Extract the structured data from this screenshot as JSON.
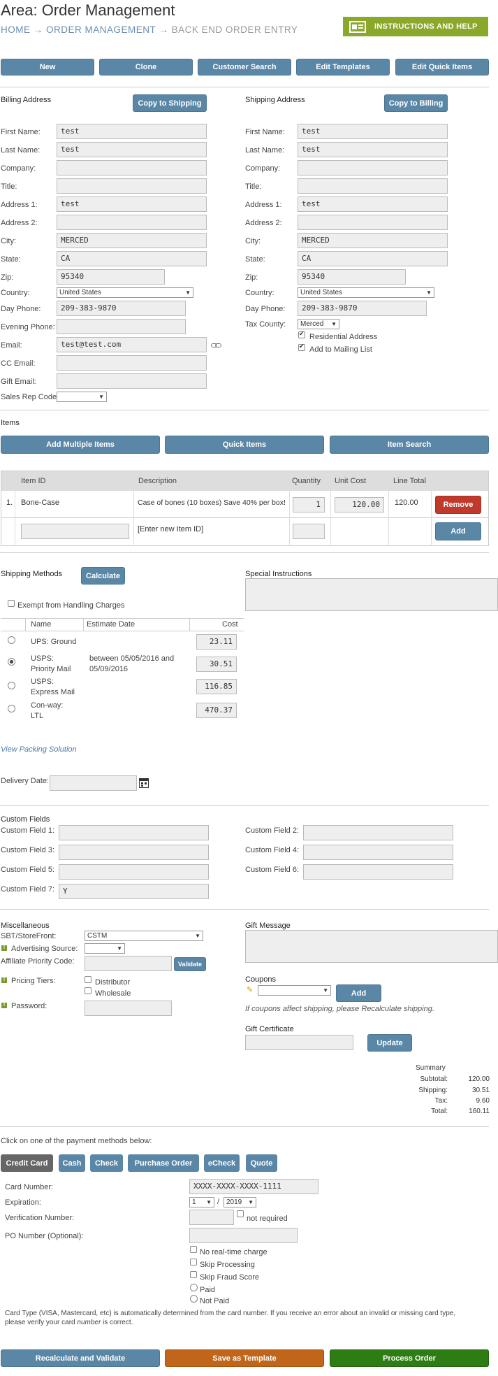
{
  "header": {
    "area_title": "Area: Order Management",
    "breadcrumb": {
      "home": "HOME",
      "arrow1": "→",
      "section": "ORDER MANAGEMENT",
      "arrow2": "→",
      "current": "BACK END ORDER ENTRY"
    },
    "help_button": "INSTRUCTIONS AND HELP"
  },
  "toolbar": {
    "new": "New",
    "clone": "Clone",
    "customer_search": "Customer Search",
    "edit_templates": "Edit Templates",
    "edit_quick_items": "Edit Quick Items"
  },
  "billing": {
    "heading": "Billing Address",
    "copy_button": "Copy to Shipping",
    "labels": {
      "first": "First Name:",
      "last": "Last Name:",
      "company": "Company:",
      "title": "Title:",
      "addr1": "Address 1:",
      "addr2": "Address 2:",
      "city": "City:",
      "state": "State:",
      "zip": "Zip:",
      "country": "Country:",
      "day_phone": "Day Phone:",
      "eve_phone": "Evening Phone:",
      "email": "Email:",
      "cc_email": "CC Email:",
      "gift_email": "Gift Email:",
      "sales_rep": "Sales Rep Code:"
    },
    "values": {
      "first": "test",
      "last": "test",
      "company": "",
      "title": "",
      "addr1": "test",
      "addr2": "",
      "city": "MERCED",
      "state": "CA",
      "zip": "95340",
      "country": "United States",
      "day_phone": "209-383-9870",
      "eve_phone": "",
      "email": "test@test.com",
      "cc_email": "",
      "gift_email": "",
      "sales_rep": ""
    }
  },
  "shipping_addr": {
    "heading": "Shipping Address",
    "copy_button": "Copy to Billing",
    "labels": {
      "first": "First Name:",
      "last": "Last Name:",
      "company": "Company:",
      "title": "Title:",
      "addr1": "Address 1:",
      "addr2": "Address 2:",
      "city": "City:",
      "state": "State:",
      "zip": "Zip:",
      "country": "Country:",
      "day_phone": "Day Phone:",
      "tax_county": "Tax County:",
      "residential": "Residential Address",
      "mailing": "Add to Mailing List"
    },
    "values": {
      "first": "test",
      "last": "test",
      "company": "",
      "title": "",
      "addr1": "test",
      "addr2": "",
      "city": "MERCED",
      "state": "CA",
      "zip": "95340",
      "country": "United States",
      "day_phone": "209-383-9870",
      "tax_county": "Merced"
    }
  },
  "items": {
    "heading": "Items",
    "add_multiple": "Add Multiple Items",
    "quick_items": "Quick Items",
    "item_search": "Item Search",
    "columns": {
      "id": "Item ID",
      "desc": "Description",
      "qty": "Quantity",
      "cost": "Unit Cost",
      "total": "Line Total"
    },
    "rows": [
      {
        "num": "1.",
        "id": "Bone-Case",
        "desc": "Case of bones (10 boxes) Save 40% per box!",
        "qty": "1",
        "cost": "120.00",
        "total": "120.00",
        "action": "Remove"
      }
    ],
    "new_row": {
      "placeholder_desc": "[Enter new Item ID]",
      "action": "Add"
    }
  },
  "shipping_methods": {
    "heading": "Shipping Methods",
    "calculate": "Calculate",
    "exempt": "Exempt from Handling Charges",
    "columns": {
      "name": "Name",
      "date": "Estimate Date",
      "cost": "Cost"
    },
    "rows": [
      {
        "name": "UPS: Ground",
        "date": "",
        "cost": "23.11"
      },
      {
        "name": "USPS:\nPriority Mail",
        "date": "between 05/05/2016 and\n05/09/2016",
        "cost": "30.51"
      },
      {
        "name": "USPS:\nExpress Mail",
        "date": "",
        "cost": "116.85"
      },
      {
        "name": "Con-way:\nLTL",
        "date": "",
        "cost": "470.37"
      }
    ],
    "packing_link": "View Packing Solution",
    "delivery_date_label": "Delivery Date:"
  },
  "special_instructions": {
    "heading": "Special Instructions"
  },
  "custom_fields": {
    "heading": "Custom Fields",
    "fields": [
      {
        "label": "Custom Field 1:",
        "value": ""
      },
      {
        "label": "Custom Field 2:",
        "value": ""
      },
      {
        "label": "Custom Field 3:",
        "value": ""
      },
      {
        "label": "Custom Field 4:",
        "value": ""
      },
      {
        "label": "Custom Field 5:",
        "value": ""
      },
      {
        "label": "Custom Field 6:",
        "value": ""
      },
      {
        "label": "Custom Field 7:",
        "value": "Y"
      }
    ]
  },
  "misc": {
    "heading": "Miscellaneous",
    "storefront_label": "SBT/StoreFront:",
    "storefront_value": "CSTM",
    "adv_label": "Advertising Source:",
    "affiliate_label": "Affiliate Priority Code:",
    "validate": "Validate",
    "pricing_label": "Pricing Tiers:",
    "distributor": "Distributor",
    "wholesale": "Wholesale",
    "password_label": "Password:"
  },
  "gift": {
    "message_heading": "Gift Message",
    "coupons_heading": "Coupons",
    "add_coupon": "Add",
    "coupon_note": "If coupons affect shipping, please Recalculate shipping.",
    "certificate_heading": "Gift Certificate",
    "update": "Update"
  },
  "summary": {
    "heading": "Summary",
    "subtotal_label": "Subtotal:",
    "subtotal": "120.00",
    "shipping_label": "Shipping:",
    "shipping": "30.51",
    "tax_label": "Tax:",
    "tax": "9.60",
    "total_label": "Total:",
    "total": "160.11"
  },
  "payment": {
    "prompt": "Click on one of the payment methods below:",
    "methods": [
      "Credit Card",
      "Cash",
      "Check",
      "Purchase Order",
      "eCheck",
      "Quote"
    ],
    "card_number_label": "Card Number:",
    "card_number": "XXXX-XXXX-XXXX-1111",
    "expiration_label": "Expiration:",
    "exp_month": "1",
    "exp_sep": "/",
    "exp_year": "2019",
    "verification_label": "Verification Number:",
    "not_required": "not required",
    "po_label": "PO Number (Optional):",
    "no_realtime": "No real-time charge",
    "skip_processing": "Skip Processing",
    "skip_fraud": "Skip Fraud Score",
    "paid": "Paid",
    "not_paid": "Not Paid",
    "note_a": "Card Type (VISA, Mastercard, etc) is automatically determined from the card number. If you receive an error about an invalid or missing card type,",
    "note_b1": "please verify your card ",
    "note_b_em": "number",
    "note_b2": " is correct."
  },
  "footer": {
    "recalculate": "Recalculate and Validate",
    "save_template": "Save as Template",
    "process": "Process Order"
  },
  "colors": {
    "accent": "#5b87a7",
    "help_green": "#8aa92a",
    "remove_red": "#c0392b",
    "template_orange": "#c0651a",
    "process_green": "#2e7d14",
    "credit_dark": "#666666"
  }
}
